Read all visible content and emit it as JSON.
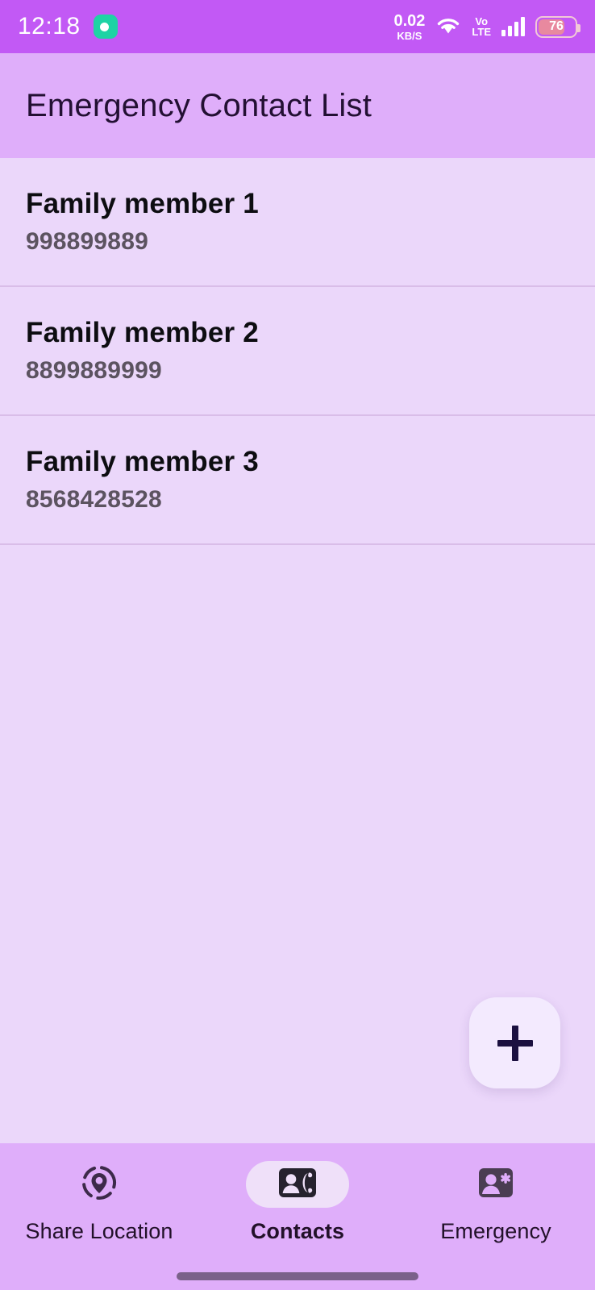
{
  "status_bar": {
    "clock": "12:18",
    "app_indicator_icon": "app-dot-icon",
    "network_speed_value": "0.02",
    "network_speed_unit": "KB/S",
    "wifi_icon": "wifi-icon",
    "volte_line1": "Vo",
    "volte_line2": "LTE",
    "signal_icon": "signal-bars-icon",
    "battery_percent": "76",
    "battery_icon": "battery-icon"
  },
  "app_bar": {
    "title": "Emergency Contact List"
  },
  "contacts": [
    {
      "name": "Family member 1",
      "phone": "998899889"
    },
    {
      "name": "Family member 2",
      "phone": "8899889999"
    },
    {
      "name": "Family member 3",
      "phone": "8568428528"
    }
  ],
  "fab": {
    "icon": "plus-icon",
    "label": "+"
  },
  "bottom_nav": {
    "items": [
      {
        "label": "Share Location",
        "icon": "share-location-icon",
        "active": false
      },
      {
        "label": "Contacts",
        "icon": "contacts-card-icon",
        "active": true
      },
      {
        "label": "Emergency",
        "icon": "emergency-contact-icon",
        "active": false
      }
    ]
  },
  "colors": {
    "status_bar": "#C259F5",
    "app_bar": "#DFAEFA",
    "background": "#EBD7FA",
    "bottom_nav": "#DFAEFA",
    "active_pill": "#EFE0F9",
    "fab_bg": "#F3EAFE",
    "fab_icon": "#1B1040",
    "text_primary": "#0D0D11",
    "text_secondary": "#5C5360"
  }
}
